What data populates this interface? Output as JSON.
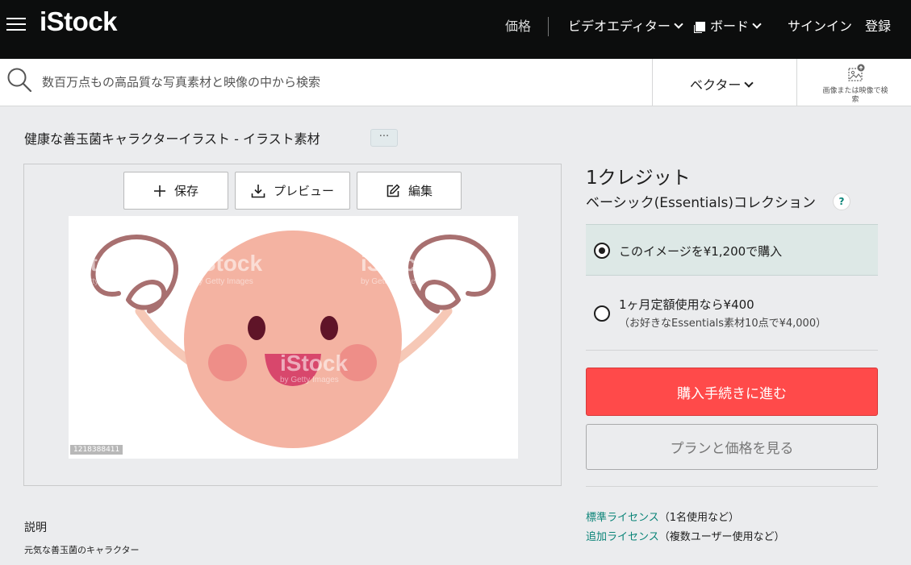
{
  "header": {
    "logo": "iStock",
    "nav": {
      "price": "価格",
      "video_editor": "ビデオエディター",
      "board": "ボード",
      "signin": "サインイン",
      "register": "登録"
    }
  },
  "search": {
    "placeholder": "数百万点もの高品質な写真素材と映像の中から検索",
    "media_type": "ベクター",
    "image_search_label": "画像または映像で検索"
  },
  "asset": {
    "title": "健康な善玉菌キャラクターイラスト - イラスト素材",
    "more_label": "···",
    "actions": {
      "save": "保存",
      "preview": "プレビュー",
      "edit": "編集"
    },
    "watermark": "iStock",
    "watermark_sub": "by Getty Images",
    "image_id": "1218388411"
  },
  "purchase": {
    "credits": "1クレジット",
    "collection": "ベーシック(Essentials)コレクション",
    "help": "?",
    "option_single": "このイメージを¥1,200で購入",
    "option_subscription": "1ヶ月定額使用なら¥400",
    "option_subscription_note": "（お好きなEssentials素材10点で¥4,000）",
    "buy_button": "購入手続きに進む",
    "plans_button": "プランと価格を見る",
    "license_standard_link": "標準ライセンス",
    "license_standard_note": "（1名使用など）",
    "license_extended_link": "追加ライセンス",
    "license_extended_note": "（複数ユーザー使用など）"
  },
  "description": {
    "heading": "説明",
    "text": "元気な善玉菌のキャラクター"
  },
  "colors": {
    "brand_red": "#ff4a4a",
    "link_teal": "#0b8478",
    "header_bg": "#0c0d0d",
    "selected_option_bg": "#dde8e6"
  }
}
